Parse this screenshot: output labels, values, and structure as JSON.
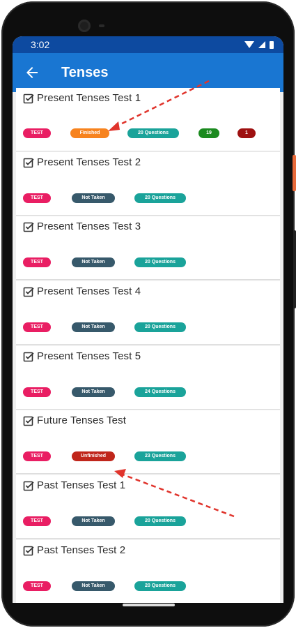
{
  "status": {
    "time": "3:02"
  },
  "appbar": {
    "title": "Tenses"
  },
  "tests": [
    {
      "title": "Present Tenses Test 1",
      "type": "TEST",
      "status": "Finished",
      "questions": "20 Questions",
      "correct": "19",
      "wrong": "1"
    },
    {
      "title": "Present Tenses Test 2",
      "type": "TEST",
      "status": "Not Taken",
      "questions": "20 Questions"
    },
    {
      "title": "Present Tenses Test 3",
      "type": "TEST",
      "status": "Not Taken",
      "questions": "20 Questions"
    },
    {
      "title": "Present Tenses Test 4",
      "type": "TEST",
      "status": "Not Taken",
      "questions": "20 Questions"
    },
    {
      "title": "Present Tenses Test 5",
      "type": "TEST",
      "status": "Not Taken",
      "questions": "24 Questions"
    },
    {
      "title": "Future Tenses Test",
      "type": "TEST",
      "status": "Unfinished",
      "questions": "23 Questions"
    },
    {
      "title": "Past Tenses Test 1",
      "type": "TEST",
      "status": "Not Taken",
      "questions": "20 Questions"
    },
    {
      "title": "Past Tenses Test 2",
      "type": "TEST",
      "status": "Not Taken",
      "questions": "20 Questions"
    }
  ],
  "colors": {
    "appbar": "#1976d2",
    "statusbar": "#0d4aa0",
    "test_badge": "#e91e63",
    "not_taken_badge": "#37596b",
    "questions_badge": "#1aa39a",
    "finished_badge": "#f7831e",
    "unfinished_badge": "#c0261b",
    "correct_badge": "#1b8a1f",
    "wrong_badge": "#9e1010",
    "annotation_arrow": "#e0342c"
  },
  "icons": {
    "back": "arrow-back-icon",
    "check": "checkbox-checked-icon",
    "wifi": "wifi-icon",
    "signal": "signal-icon",
    "battery": "battery-icon"
  }
}
